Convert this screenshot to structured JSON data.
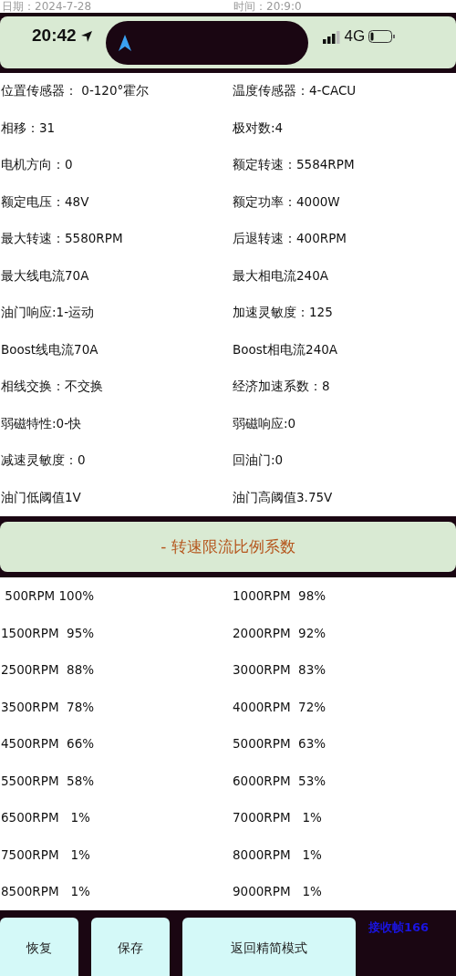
{
  "header": {
    "date": "日期：2024-7-28",
    "time": "时间：20:9:0"
  },
  "status_bar": {
    "time": "20:42",
    "network": "4G"
  },
  "sections": [
    {
      "rows": [
        [
          "位置传感器： 0-120°霍尔",
          "温度传感器：4-CACU"
        ],
        [
          "相移：31",
          "极对数:4"
        ],
        [
          "电机方向：0",
          "额定转速：5584RPM"
        ],
        [
          "额定电压：48V",
          "额定功率：4000W"
        ],
        [
          "最大转速：5580RPM",
          "后退转速：400RPM"
        ],
        [
          "最大线电流70A",
          "最大相电流240A"
        ],
        [
          "油门响应:1-运动",
          "加速灵敏度：125"
        ],
        [
          "Boost线电流70A",
          "Boost相电流240A"
        ]
      ]
    },
    {
      "rows": [
        [
          "相线交换：不交换",
          "经济加速系数：8"
        ],
        [
          "弱磁特性:0-快",
          "弱磁响应:0"
        ],
        [
          "减速灵敏度：0",
          "回油门:0"
        ],
        [
          "油门低阈值1V",
          "油门高阈值3.75V"
        ]
      ]
    }
  ],
  "speed_limit": {
    "toggle": "- 转速限流比例系数",
    "rows": [
      [
        " 500RPM 100%",
        "1000RPM  98%"
      ],
      [
        "1500RPM  95%",
        "2000RPM  92%"
      ],
      [
        "2500RPM  88%",
        "3000RPM  83%"
      ],
      [
        "3500RPM  78%",
        "4000RPM  72%"
      ],
      [
        "4500RPM  66%",
        "5000RPM  63%"
      ],
      [
        "5500RPM  58%",
        "6000RPM  53%"
      ],
      [
        "6500RPM   1%",
        "7000RPM   1%"
      ],
      [
        "7500RPM   1%",
        "8000RPM   1%"
      ],
      [
        "8500RPM   1%",
        "9000RPM   1%"
      ]
    ]
  },
  "footer": {
    "buttons": [
      "恢复",
      "保存",
      "返回精简模式"
    ],
    "frame_counter": "接收帧166"
  }
}
